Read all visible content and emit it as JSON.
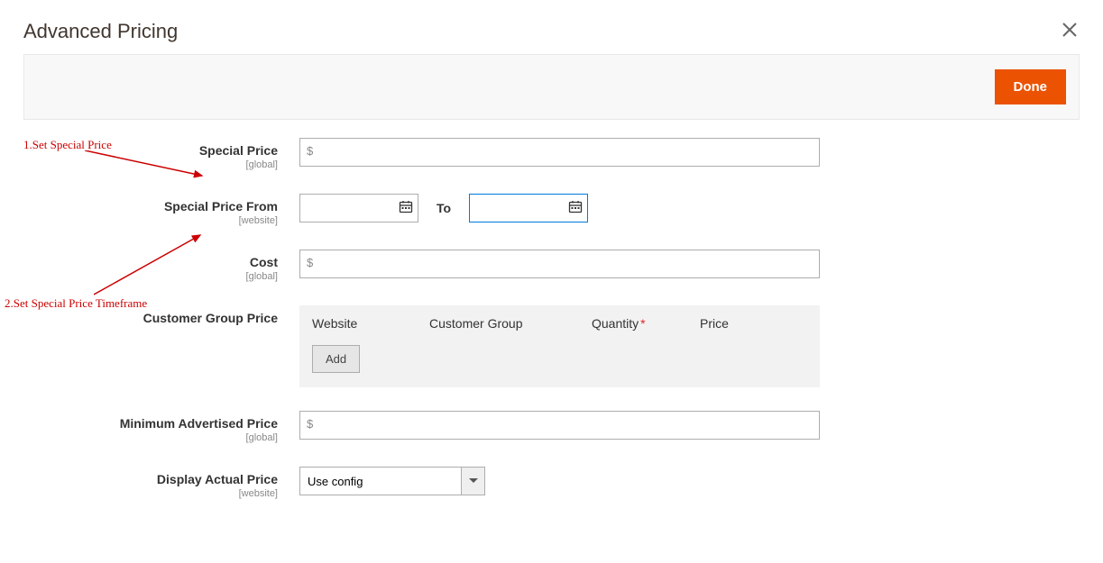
{
  "modal": {
    "title": "Advanced Pricing",
    "done_label": "Done"
  },
  "annotations": {
    "anno1": "1.Set Special Price",
    "anno2": "2.Set Special Price Timeframe"
  },
  "fields": {
    "special_price": {
      "label": "Special Price",
      "scope": "[global]",
      "currency": "$",
      "value": ""
    },
    "special_price_from": {
      "label": "Special Price From",
      "scope": "[website]",
      "to_label": "To",
      "from_value": "",
      "to_value": ""
    },
    "cost": {
      "label": "Cost",
      "scope": "[global]",
      "currency": "$",
      "value": ""
    },
    "customer_group_price": {
      "label": "Customer Group Price",
      "columns": {
        "website": "Website",
        "customer_group": "Customer Group",
        "quantity": "Quantity",
        "price": "Price"
      },
      "add_label": "Add"
    },
    "map": {
      "label": "Minimum Advertised Price",
      "scope": "[global]",
      "currency": "$",
      "value": ""
    },
    "display_actual": {
      "label": "Display Actual Price",
      "scope": "[website]",
      "selected": "Use config"
    }
  }
}
